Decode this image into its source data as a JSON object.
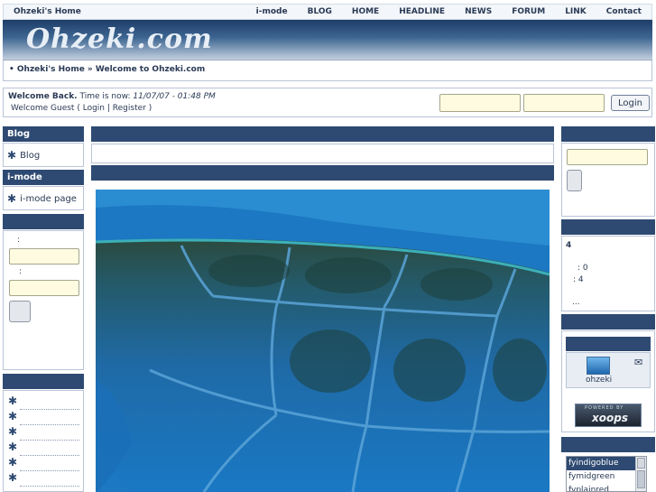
{
  "site": {
    "name": "Ohzeki's Home",
    "logo": "Ohzeki.com"
  },
  "nav": [
    {
      "label": "i-mode"
    },
    {
      "label": "BLOG"
    },
    {
      "label": "HOME"
    },
    {
      "label": "HEADLINE"
    },
    {
      "label": "NEWS"
    },
    {
      "label": "FORUM"
    },
    {
      "label": "LINK"
    },
    {
      "label": "Contact"
    }
  ],
  "breadcrumb": {
    "text": "• Ohzeki's Home » Welcome to Ohzeki.com"
  },
  "welcome": {
    "prefix": "Welcome Back.",
    "time_label": "Time is now:",
    "time_value": "11/07/07 - 01:48 PM",
    "guest_text": "Welcome Guest (",
    "login_link": "Login",
    "separator": "|",
    "register_link": "Register",
    "close": ")",
    "login_button": "Login"
  },
  "left": {
    "blog_title": "Blog",
    "blog_item": "Blog",
    "imode_title": "i-mode",
    "imode_item": "i-mode page",
    "login_label1": ":",
    "login_label2": ":"
  },
  "right": {
    "online_count": "4",
    "online_members": ": 0",
    "online_guests": ": 4",
    "more": "...",
    "user_name": "ohzeki",
    "powered_by": "POWERED BY",
    "xoops": "xoops",
    "themes": [
      "fyindigoblue",
      "fymidgreen",
      "fyplainred"
    ]
  },
  "colors": {
    "header_navy": "#2e4a72",
    "input_yellow": "#fffbe0",
    "text": "#2a3a55"
  }
}
